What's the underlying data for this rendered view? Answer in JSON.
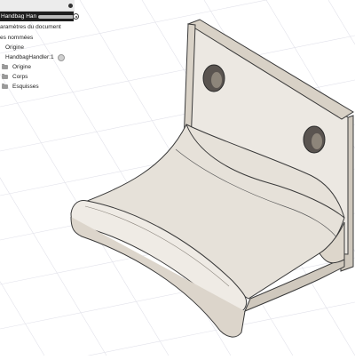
{
  "browser": {
    "document_name": "Handbag Handler Pocket Desk...",
    "items": {
      "document_settings": "aramètres du document",
      "named_views": "es nommées",
      "origin_top": "Origine",
      "component": "HandbagHandler:1",
      "origin": "Origine",
      "bodies": "Corps",
      "sketches": "Esquisses"
    }
  },
  "colors": {
    "part_face": "#ede9e3",
    "part_shadow": "#d8d2c8",
    "part_edge": "#3a3a3a",
    "grid": "#e4e4ea",
    "axis_orange": "#f5c24f",
    "panel_selected_bg": "#1e1e1e"
  },
  "icons": [
    "folder-icon",
    "eye-icon",
    "radio-icon",
    "bullet-icon",
    "origin-axes-icon"
  ]
}
